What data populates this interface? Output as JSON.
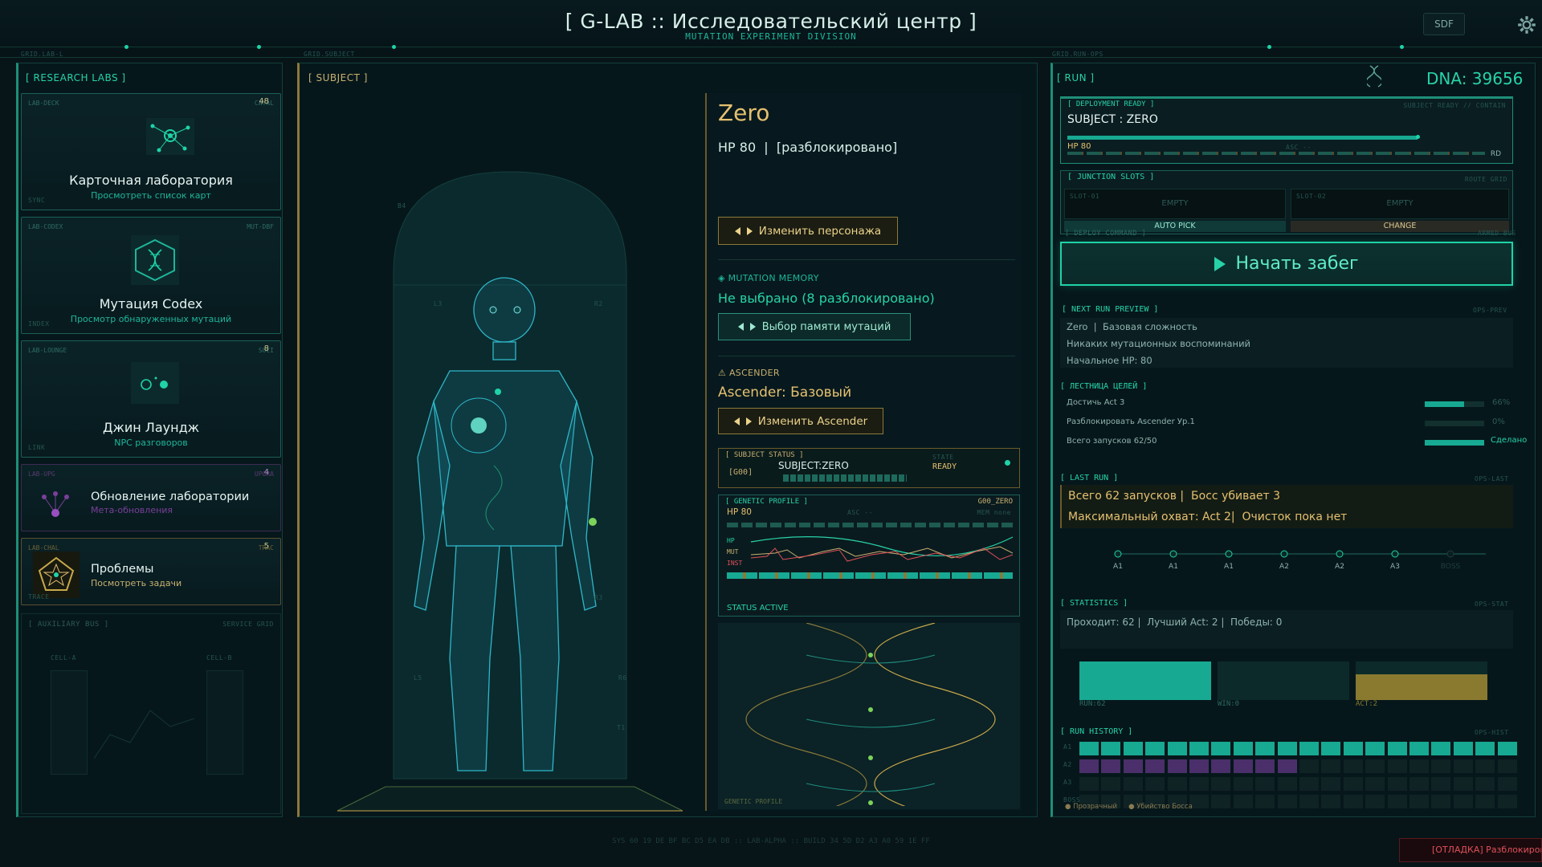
{
  "header": {
    "title": "[ G-LAB :: Исследовательский центр ]",
    "subtitle": "MUTATION EXPERIMENT DIVISION",
    "sdf_label": "SDF",
    "grid_labels": [
      "GRID.LAB-L",
      "GRID.SUBJECT",
      "GRID.RUN-OPS"
    ]
  },
  "left": {
    "title": "[ RESEARCH LABS ]",
    "cards": [
      {
        "tag": "LAB-DECK",
        "tag2": "CATAL",
        "badge": "48",
        "name": "Карточная лаборатория",
        "sub": "Просмотреть список карт",
        "foot": "SYNC",
        "icon": "network-node-icon"
      },
      {
        "tag": "LAB-CODEX",
        "tag2": "MUT-DBF",
        "badge": "",
        "name": "Мутация Codex",
        "sub": "Просмотр обнаруженных мутаций",
        "foot": "INDEX",
        "icon": "dna-hexagon-icon"
      },
      {
        "tag": "LAB-LOUNGE",
        "tag2": "SOCI",
        "badge": "8",
        "name": "Джин Лаундж",
        "sub": "NPC разговоров",
        "foot": "LINK",
        "icon": "chat-orbs-icon"
      },
      {
        "tag": "LAB-UPG",
        "tag2": "UPGRA",
        "badge": "4",
        "name": "Обновление лаборатории",
        "sub": "Мета-обновления",
        "foot": "",
        "icon": "upgrade-tree-icon"
      },
      {
        "tag": "LAB-CHAL",
        "tag2": "TRAC",
        "badge": "5",
        "name": "Проблемы",
        "sub": "Посмотреть задачи",
        "foot": "TRACE",
        "icon": "pentagon-star-icon"
      }
    ],
    "aux_title": "[ AUXILIARY BUS ]",
    "aux_tag": "SERVICE GRID",
    "aux_cells": [
      "CELL-A",
      "CELL-B"
    ]
  },
  "subject": {
    "title": "[ SUBJECT ]",
    "name": "Zero",
    "hp_line": "HP 80  |  [разблокировано]",
    "change_char": "Изменить персонажа",
    "mutation_label": "MUTATION MEMORY",
    "mutation_value": "Не выбрано (8 разблокировано)",
    "mutation_btn": "Выбор памяти мутаций",
    "ascender_label": "ASCENDER",
    "ascender_value": "Ascender: Базовый",
    "ascender_btn": "Изменить Ascender",
    "status_title": "[ SUBJECT STATUS ]",
    "status_id": "[G00]",
    "status_subject": "SUBJECT:ZERO",
    "status_ready_lbl": "STATE",
    "status_ready": "READY",
    "genetic_title": "[ GENETIC PROFILE ]",
    "genetic_code": "G00_ZERO",
    "genetic_hp": "HP 80",
    "genetic_asc": "ASC --",
    "genetic_mem": "MEM none",
    "genetic_rows": [
      "HP",
      "MUT",
      "INST"
    ],
    "status_active": "STATUS ACTIVE",
    "helix_footer": "GENETIC PROFILE",
    "marker_labels": [
      "B4",
      "L3",
      "R2",
      "L7",
      "R3",
      "L5",
      "R6",
      "L9",
      "T1",
      "G1"
    ]
  },
  "run": {
    "title": "[ RUN ]",
    "dna_label": "DNA: 39656",
    "deploy_title": "[ DEPLOYMENT READY ]",
    "deploy_right": "SUBJECT READY // CONTAIN",
    "deploy_subject": "SUBJECT : ZERO",
    "deploy_hp": "HP 80",
    "deploy_asc": "ASC --",
    "deploy_rd": "RD",
    "junction_title": "[ JUNCTION SLOTS ]",
    "junction_right": "ROUTE GRID",
    "slots": [
      {
        "id": "SLOT-01",
        "state": "EMPTY",
        "action": "AUTO PICK"
      },
      {
        "id": "SLOT-02",
        "state": "EMPTY",
        "action": "CHANGE"
      }
    ],
    "deploy_cmd": "[ DEPLOY COMMAND ]",
    "deploy_cmd_right": "ARMED BUS",
    "start_btn": "Начать забег",
    "preview_title": "[ NEXT RUN PREVIEW ]",
    "preview_tag": "OPS-PREV",
    "preview_lines": [
      "Zero  |  Базовая сложность",
      "Никаких мутационных воспоминаний",
      "Начальное HP: 80"
    ],
    "goals_title": "[ ЛЕСТНИЦА ЦЕЛЕЙ ]",
    "goals": [
      {
        "label": "Достичь Act 3",
        "pct": "66%",
        "fill": 0.66
      },
      {
        "label": "Разблокировать Ascender Ур.1",
        "pct": "0%",
        "fill": 0
      },
      {
        "label": "Всего запусков 62/50",
        "pct": "Сделано",
        "fill": 1
      }
    ],
    "last_title": "[ LAST RUN ]",
    "last_tag": "OPS-LAST",
    "last_line1": "Всего 62 запусков |  Босс убивает 3",
    "last_line2": "Максимальный охват: Act 2|  Очисток пока нет",
    "timeline": [
      "A1",
      "A1",
      "A1",
      "A2",
      "A2",
      "A3",
      "BOSS"
    ],
    "stats_title": "[ STATISTICS ]",
    "stats_tag": "OPS-STAT",
    "stats_line": "Проходит: 62 |  Лучший Act: 2 |  Победы: 0",
    "stat_bars": [
      {
        "label": "RUN:62",
        "fill": 1
      },
      {
        "label": "WIN:0",
        "fill": 0
      },
      {
        "label": "ACT:2",
        "fill": 0.66
      }
    ],
    "history_title": "[ RUN HISTORY ]",
    "history_tag": "OPS-HIST",
    "history_rows": [
      "A1",
      "A2",
      "A3",
      "BOSS"
    ],
    "history_legend": [
      "Прозрачный",
      "Убийство Босса"
    ],
    "history_filled": [
      20,
      10,
      0,
      0
    ]
  },
  "footer": {
    "hex": "SYS 60 19 DE BF BC D5 EA DB :: LAB-ALPHA :: BUILD 34 5D D2 A3 A0 59 1E FF",
    "debug": "[ОТЛАДКА] Разблокировать"
  },
  "colors": {
    "accent": "#1fd3a8",
    "gold": "#e5c070",
    "teal_bar": "#17a992",
    "red": "#e0505a"
  }
}
